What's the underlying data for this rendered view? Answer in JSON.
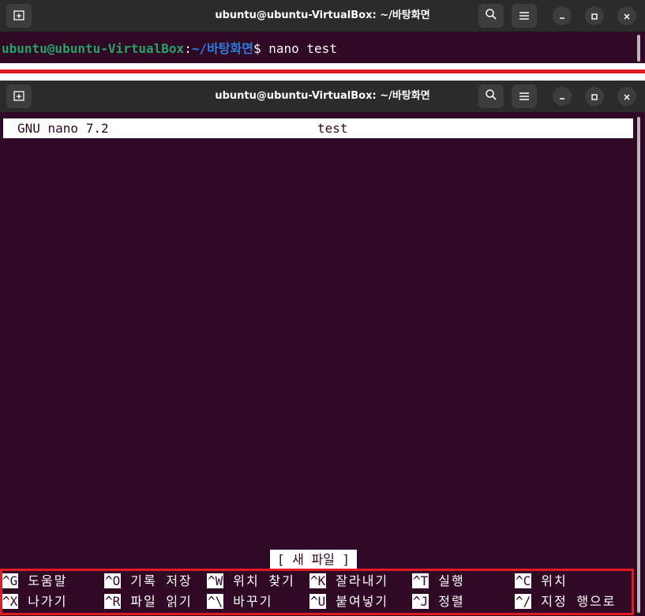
{
  "top_window": {
    "title": "ubuntu@ubuntu-VirtualBox: ~/바탕화면",
    "prompt_user": "ubuntu@ubuntu-VirtualBox",
    "prompt_colon": ":",
    "prompt_path": "~/바탕화면",
    "prompt_symbol": "$ ",
    "command": "nano test"
  },
  "bottom_window": {
    "title": "ubuntu@ubuntu-VirtualBox: ~/바탕화면",
    "nano_version": "GNU nano 7.2",
    "filename": "test",
    "status": "[ 새 파일 ]",
    "shortcuts_row1": [
      {
        "key": "^G",
        "label": "도움말"
      },
      {
        "key": "^O",
        "label": "기록 저장"
      },
      {
        "key": "^W",
        "label": "위치 찾기"
      },
      {
        "key": "^K",
        "label": "잘라내기"
      },
      {
        "key": "^T",
        "label": "실행"
      },
      {
        "key": "^C",
        "label": "위치"
      }
    ],
    "shortcuts_row2": [
      {
        "key": "^X",
        "label": "나가기"
      },
      {
        "key": "^R",
        "label": "파일 읽기"
      },
      {
        "key": "^\\",
        "label": "바꾸기"
      },
      {
        "key": "^U",
        "label": "붙여넣기"
      },
      {
        "key": "^J",
        "label": "정렬"
      },
      {
        "key": "^/",
        "label": "지정 행으로"
      }
    ]
  },
  "colors": {
    "terminal_bg": "#300a24",
    "titlebar_bg": "#2b2b2b",
    "prompt_user": "#26a269",
    "prompt_path": "#2a7bde",
    "highlight": "#e01b24"
  },
  "icons": {
    "new_tab": "new-tab-icon",
    "search": "search-icon",
    "menu": "hamburger-menu-icon",
    "minimize": "minimize-icon",
    "maximize": "maximize-icon",
    "close": "close-icon"
  }
}
